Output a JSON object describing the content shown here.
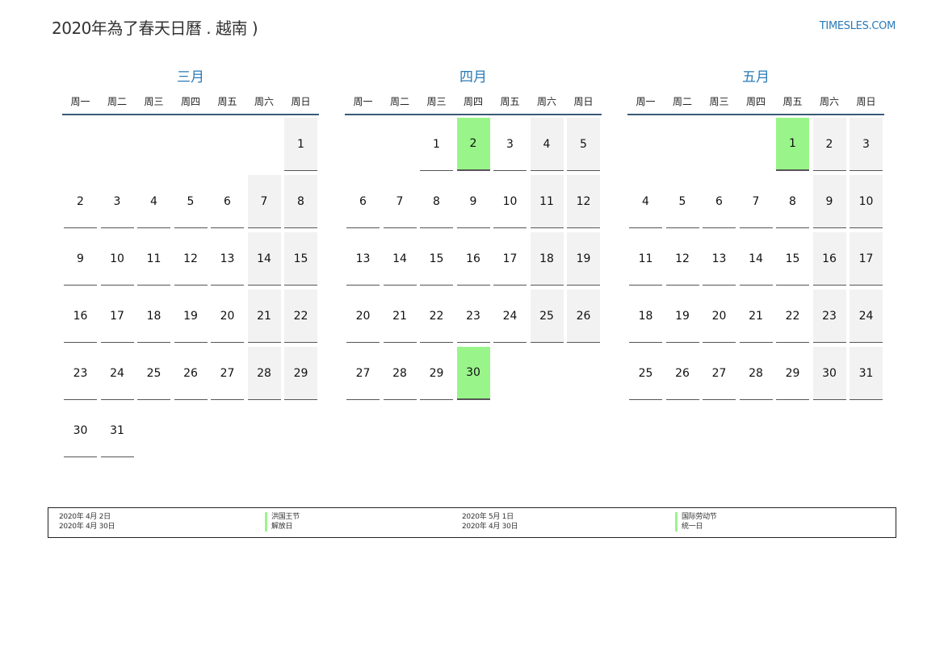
{
  "header": {
    "title": "2020年為了春天日曆 . 越南 )",
    "site": "TIMESLES.COM"
  },
  "weekdays": [
    "周一",
    "周二",
    "周三",
    "周四",
    "周五",
    "周六",
    "周日"
  ],
  "months": [
    {
      "title": "三月",
      "offset": 6,
      "days": 31,
      "holidays": []
    },
    {
      "title": "四月",
      "offset": 2,
      "days": 30,
      "holidays": [
        2,
        30
      ]
    },
    {
      "title": "五月",
      "offset": 4,
      "days": 31,
      "holidays": [
        1
      ]
    }
  ],
  "legend": [
    {
      "dates": [
        "2020年 4月 2日",
        "2020年 4月 30日"
      ],
      "names": [
        "洪国王节",
        "解放日"
      ]
    },
    {
      "dates": [
        "2020年 5月 1日",
        "2020年 4月 30日"
      ],
      "names": [
        "国际劳动节",
        "统一日"
      ]
    }
  ],
  "colors": {
    "holiday": "#99f58a",
    "weekend": "#f2f2f2",
    "accent": "#2a7ab8"
  }
}
